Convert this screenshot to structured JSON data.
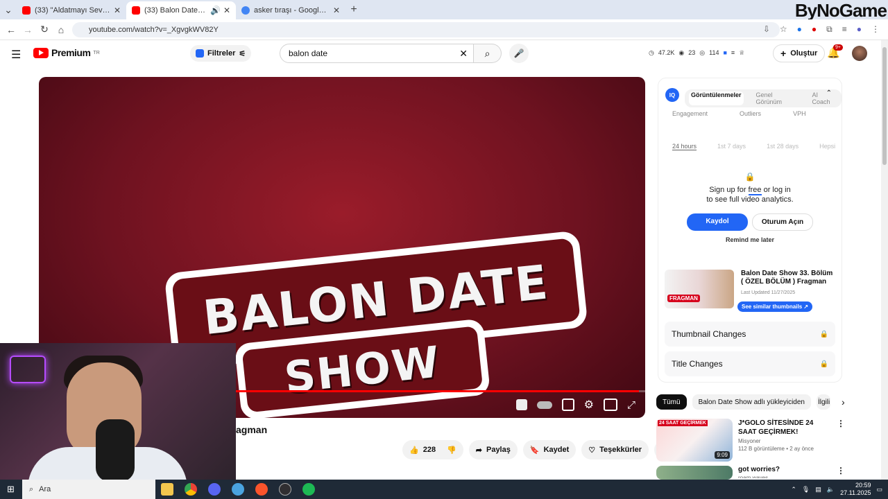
{
  "browser": {
    "tabs": [
      {
        "title": "(33) \"Aldatmayı Seviyorum\" | G",
        "active": false,
        "fav_color": "#ff0000"
      },
      {
        "title": "(33) Balon Date Show 33. B",
        "active": true,
        "fav_color": "#ff0000"
      },
      {
        "title": "asker tıraşı - Google'da Ara",
        "active": false,
        "fav_color": "#4285f4"
      }
    ],
    "new_tab": "+",
    "url": "youtube.com/watch?v=_XgvgkWV82Y"
  },
  "overlay_brand": "ByNoGame",
  "youtube": {
    "logo": "Premium",
    "logo_badge": "TR",
    "filters_label": "Filtreler",
    "search_value": "balon date",
    "stats": {
      "views": "47.2K",
      "mid": "23",
      "right": "114"
    },
    "create_label": "Oluştur",
    "notif_count": "9+"
  },
  "video": {
    "thumb_line1": "BALON DATE",
    "thumb_line2": "SHOW",
    "progress_fraction": 0.99,
    "title_partial": "agman",
    "like_count": "228",
    "share_label": "Paylaş",
    "save_label": "Kaydet",
    "thanks_label": "Teşekkürler"
  },
  "sidebar": {
    "iq_label": "IQ",
    "tabs": [
      "Görüntülenmeler",
      "Genel Görünüm",
      "AI Coach"
    ],
    "metrics": [
      "Engagement",
      "Outliers",
      "VPH"
    ],
    "ranges": [
      "24 hours",
      "1st 7 days",
      "1st 28 days",
      "Hepsi"
    ],
    "lock_line1_a": "Sign up for ",
    "lock_line1_link": "free",
    "lock_line1_b": " or log in",
    "lock_line2": "to see full video analytics.",
    "signup_label": "Kaydol",
    "login_label": "Oturum Açın",
    "remind_label": "Remind me later",
    "card_title": "Balon Date Show 33. Bölüm ( ÖZEL BÖLÜM ) Fragman",
    "card_date": "Last Updated 11/27/2025",
    "card_thumb_text": "FRAGMAN",
    "similar_label": "See similar thumbnails",
    "thumb_changes": "Thumbnail Changes",
    "title_changes": "Title Changes"
  },
  "chips": [
    "Tümü",
    "Balon Date Show adlı yükleyiciden",
    "İlgili"
  ],
  "recommended": [
    {
      "title": "J*GOLO SİTESİNDE 24 SAAT GEÇİRMEK!",
      "channel": "Misyoner",
      "meta": "112 B görüntüleme • 2 ay önce",
      "duration": "9:09",
      "thumb_text": "24 SAAT GEÇİRMEK"
    },
    {
      "title": "got worries?",
      "channel": "roam waves",
      "meta": "",
      "duration": "",
      "thumb_text": ""
    }
  ],
  "taskbar": {
    "search_label": "Ara",
    "time": "20:59",
    "date": "27.11.2025"
  }
}
